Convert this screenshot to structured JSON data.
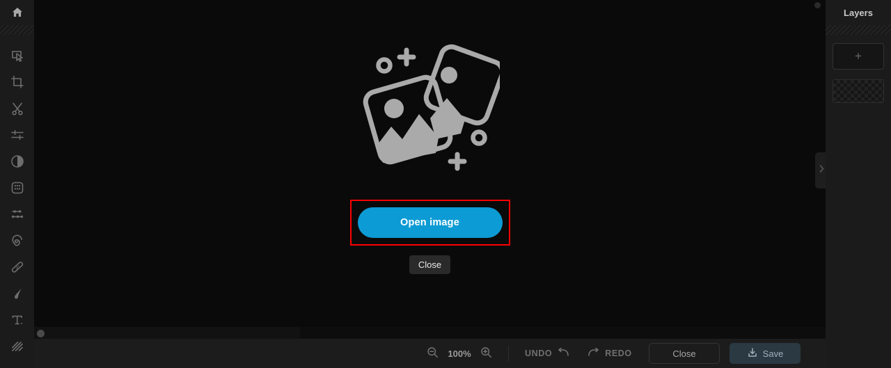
{
  "app": {
    "background_color": "#1c1c1c",
    "canvas_color": "#0a0a0a",
    "accent_color": "#0c9bd4",
    "highlight_color": "#ff0000"
  },
  "toolbar": {
    "home": {
      "name": "home",
      "icon": "home-icon"
    },
    "tools": [
      {
        "name": "select",
        "icon": "select-frame-icon"
      },
      {
        "name": "crop",
        "icon": "crop-icon"
      },
      {
        "name": "cut",
        "icon": "scissors-icon"
      },
      {
        "name": "adjust",
        "icon": "sliders-icon"
      },
      {
        "name": "contrast",
        "icon": "contrast-icon"
      },
      {
        "name": "effects",
        "icon": "dots-grid-icon"
      },
      {
        "name": "filters",
        "icon": "filter-sliders-icon"
      },
      {
        "name": "blur",
        "icon": "spiral-icon"
      },
      {
        "name": "heal",
        "icon": "bandage-icon"
      },
      {
        "name": "brush",
        "icon": "brush-icon"
      },
      {
        "name": "text",
        "icon": "text-t-icon"
      },
      {
        "name": "pattern",
        "icon": "diagonal-lines-icon"
      }
    ]
  },
  "canvas": {
    "placeholder": {
      "illustration": "two-photo-frames-icon",
      "open_image_label": "Open image",
      "close_label": "Close"
    },
    "scrollbar": {
      "orientation": "horizontal"
    },
    "collapse_handle_icon": "chevron-right-icon"
  },
  "layers": {
    "title": "Layers",
    "add_label": "+",
    "items": [
      {
        "name": "layer-thumbnail",
        "content": "transparent-checkerboard"
      }
    ]
  },
  "bottom_bar": {
    "zoom_out_icon": "zoom-out-icon",
    "zoom_level": "100%",
    "zoom_in_icon": "zoom-in-icon",
    "undo_label": "UNDO",
    "undo_icon": "undo-arrow-icon",
    "redo_label": "REDO",
    "redo_icon": "redo-arrow-icon",
    "close_label": "Close",
    "save_label": "Save",
    "save_icon": "save-download-icon"
  }
}
